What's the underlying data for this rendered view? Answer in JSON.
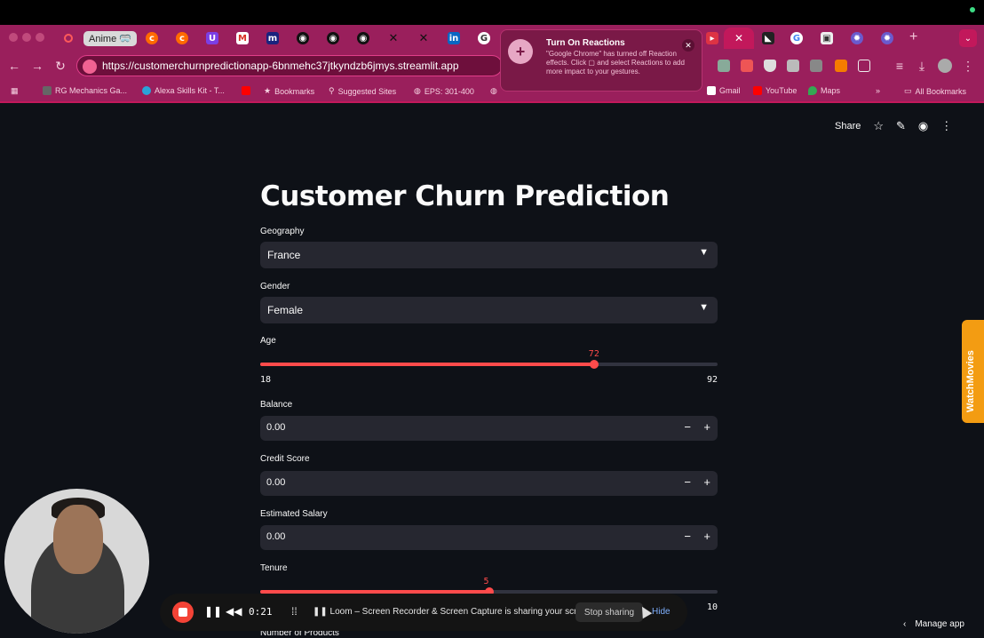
{
  "browser": {
    "tab_pill_label": "Anime 🥽",
    "url": "https://customerchurnpredictionapp-6bnmehc37jtkyndzb6jmys.streamlit.app",
    "new_tab_symbol": "+",
    "bookmarks": [
      {
        "label": "RG Mechanics Ga..."
      },
      {
        "label": "Alexa Skills Kit - T..."
      },
      {
        "label": "Bookmarks"
      },
      {
        "label": "Suggested Sites"
      },
      {
        "label": "EPS: 301-400"
      },
      {
        "label": "Gmail"
      },
      {
        "label": "YouTube"
      },
      {
        "label": "Maps"
      },
      {
        "label": "All Bookmarks"
      }
    ],
    "bookmarks_more": "»"
  },
  "notification": {
    "title": "Turn On Reactions",
    "body": "\"Google Chrome\" has turned off Reaction effects. Click ▢ and select Reactions to add more impact to your gestures.",
    "close_symbol": "✕"
  },
  "header": {
    "share_label": "Share"
  },
  "page": {
    "title": "Customer Churn Prediction",
    "geography": {
      "label": "Geography",
      "value": "France"
    },
    "gender": {
      "label": "Gender",
      "value": "Female"
    },
    "age": {
      "label": "Age",
      "value": 72,
      "min": 18,
      "max": 92
    },
    "balance": {
      "label": "Balance",
      "value": "0.00"
    },
    "credit_score": {
      "label": "Credit Score",
      "value": "0.00"
    },
    "estimated_salary": {
      "label": "Estimated Salary",
      "value": "0.00"
    },
    "tenure": {
      "label": "Tenure",
      "value": 5,
      "min": 0,
      "max": 10,
      "max_label": "10"
    },
    "next_label": "Number of Products",
    "minus_symbol": "−",
    "plus_symbol": "+"
  },
  "side_widget": {
    "label": "WatchMovies"
  },
  "loom": {
    "time": "0:21",
    "message": "Loom – Screen Recorder & Screen Capture is sharing your screen.",
    "stop_sharing": "Stop sharing",
    "hide": "Hide"
  },
  "footer": {
    "manage_app": "Manage app"
  }
}
